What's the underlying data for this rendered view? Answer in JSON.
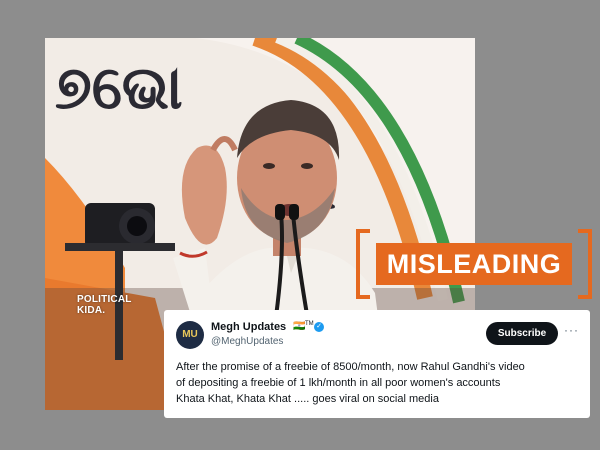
{
  "video": {
    "watermark_line1": "POLITICAL",
    "watermark_line2": "KIDA."
  },
  "stamp": {
    "label": "MISLEADING",
    "color": "#e5691f"
  },
  "tweet": {
    "avatar_text": "MU",
    "user_name": "Megh Updates",
    "flag": "🇮🇳",
    "tm": "TM",
    "verified_icon": "✓",
    "handle": "@MeghUpdates",
    "subscribe_label": "Subscribe",
    "more_label": "···",
    "text_line1": "After the promise of a freebie of 8500/month, now Rahul Gandhi's video",
    "text_line2": "of depositing a freebie of 1 lkh/month in all poor women's accounts",
    "text_line3": "Khata Khat, Khata Khat ..... goes viral on social media"
  }
}
